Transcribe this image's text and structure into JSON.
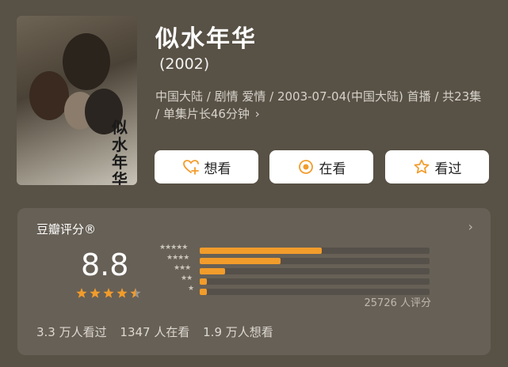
{
  "movie": {
    "title": "似水年华",
    "year": "(2002)",
    "meta": "中国大陆 / 剧情 爱情 / 2003-07-04(中国大陆) 首播 / 共23集 / 单集片长46分钟",
    "meta_chevron": "›"
  },
  "actions": {
    "want": "想看",
    "watching": "在看",
    "watched": "看过"
  },
  "rating": {
    "heading": "豆瓣评分®",
    "score": "8.8",
    "stars": 4.5,
    "distribution": [
      0.53,
      0.35,
      0.11,
      0.03,
      0.03
    ],
    "count_text": "25726 人评分",
    "stats": [
      "3.3 万人看过",
      "1347 人在看",
      "1.9 万人想看"
    ]
  },
  "poster": {
    "title_text": "似水年华"
  },
  "colors": {
    "background": "#585145",
    "card": "#676056",
    "accent": "#f29c2b",
    "button": "#ffffff"
  }
}
